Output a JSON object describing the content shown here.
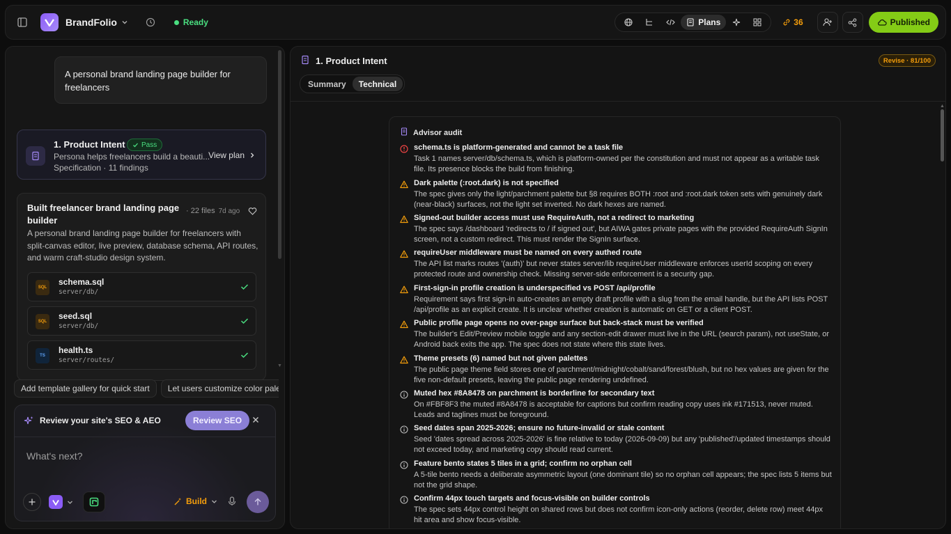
{
  "topbar": {
    "app_name": "BrandFolio",
    "status": "Ready",
    "plans_label": "Plans",
    "credits": "36",
    "published_label": "Published"
  },
  "left": {
    "prompt": "A personal brand landing page builder for freelancers",
    "intent": {
      "title": "1. Product Intent",
      "badge": "Pass",
      "desc": "Persona helps freelancers build a beauti...",
      "sub": "Specification · 11 findings",
      "view_plan": "View plan"
    },
    "built": {
      "title": "Built freelancer brand landing page builder",
      "files_count": "· 22 files",
      "age": "7d ago",
      "desc": "A personal brand landing page builder for freelancers with split-canvas editor, live preview, database schema, API routes, and warm craft-studio design system.",
      "files": [
        {
          "name": "schema.sql",
          "path": "server/db/",
          "type": "SQL"
        },
        {
          "name": "seed.sql",
          "path": "server/db/",
          "type": "SQL"
        },
        {
          "name": "health.ts",
          "path": "server/routes/",
          "type": "TS"
        }
      ]
    },
    "chips": [
      "Add template gallery for quick start",
      "Let users customize color palette"
    ],
    "composer": {
      "seo_text": "Review your site's SEO & AEO",
      "seo_button": "Review SEO",
      "placeholder": "What's next?",
      "build_label": "Build"
    }
  },
  "right": {
    "title": "1. Product Intent",
    "revise_badge": "Revise · 81/100",
    "tabs": [
      "Summary",
      "Technical"
    ],
    "audit_title": "Advisor audit",
    "findings": [
      {
        "severity": "error",
        "title": "schema.ts is platform-generated and cannot be a task file",
        "body": "Task 1 names server/db/schema.ts, which is platform-owned per the constitution and must not appear as a writable task file. Its presence blocks the build from finishing."
      },
      {
        "severity": "warning",
        "title": "Dark palette (:root.dark) is not specified",
        "body": "The spec gives only the light/parchment palette but §8 requires BOTH :root and :root.dark token sets with genuinely dark (near-black) surfaces, not the light set inverted. No dark hexes are named."
      },
      {
        "severity": "warning",
        "title": "Signed-out builder access must use RequireAuth, not a redirect to marketing",
        "body": "The spec says /dashboard 'redirects to / if signed out', but AIWA gates private pages with the provided RequireAuth SignIn screen, not a custom redirect. This must render the SignIn surface."
      },
      {
        "severity": "warning",
        "title": "requireUser middleware must be named on every authed route",
        "body": "The API list marks routes '(auth)' but never states server/lib requireUser middleware enforces userId scoping on every protected route and ownership check. Missing server-side enforcement is a security gap."
      },
      {
        "severity": "warning",
        "title": "First-sign-in profile creation is underspecified vs POST /api/profile",
        "body": "Requirement says first sign-in auto-creates an empty draft profile with a slug from the email handle, but the API lists POST /api/profile as an explicit create. It is unclear whether creation is automatic on GET or a client POST."
      },
      {
        "severity": "warning",
        "title": "Public profile page opens no over-page surface but back-stack must be verified",
        "body": "The builder's Edit/Preview mobile toggle and any section-edit drawer must live in the URL (search param), not useState, or Android back exits the app. The spec does not state where this state lives."
      },
      {
        "severity": "warning",
        "title": "Theme presets (6) named but not given palettes",
        "body": "The public page theme field stores one of parchment/midnight/cobalt/sand/forest/blush, but no hex values are given for the five non-default presets, leaving the public page rendering undefined."
      },
      {
        "severity": "info",
        "title": "Muted hex #8A8478 on parchment is borderline for secondary text",
        "body": "On #FBF8F3 the muted #8A8478 is acceptable for captions but confirm reading copy uses ink #171513, never muted. Leads and taglines must be foreground."
      },
      {
        "severity": "info",
        "title": "Seed dates span 2025-2026; ensure no future-invalid or stale content",
        "body": "Seed 'dates spread across 2025-2026' is fine relative to today (2026-09-09) but any 'published'/updated timestamps should not exceed today, and marketing copy should read current."
      },
      {
        "severity": "info",
        "title": "Feature bento states 5 tiles in a grid; confirm no orphan cell",
        "body": "A 5-tile bento needs a deliberate asymmetric layout (one dominant tile) so no orphan cell appears; the spec lists 5 items but not the grid shape."
      },
      {
        "severity": "info",
        "title": "Confirm 44px touch targets and focus-visible on builder controls",
        "body": "The spec sets 44px control height on shared rows but does not confirm icon-only actions (reorder, delete row) meet 44px hit area and show focus-visible."
      }
    ]
  },
  "colors": {
    "accent": "#8b5cf6",
    "success": "#4ade80",
    "warning": "#f59e0b",
    "error": "#ef4444",
    "published": "#84cc16"
  }
}
